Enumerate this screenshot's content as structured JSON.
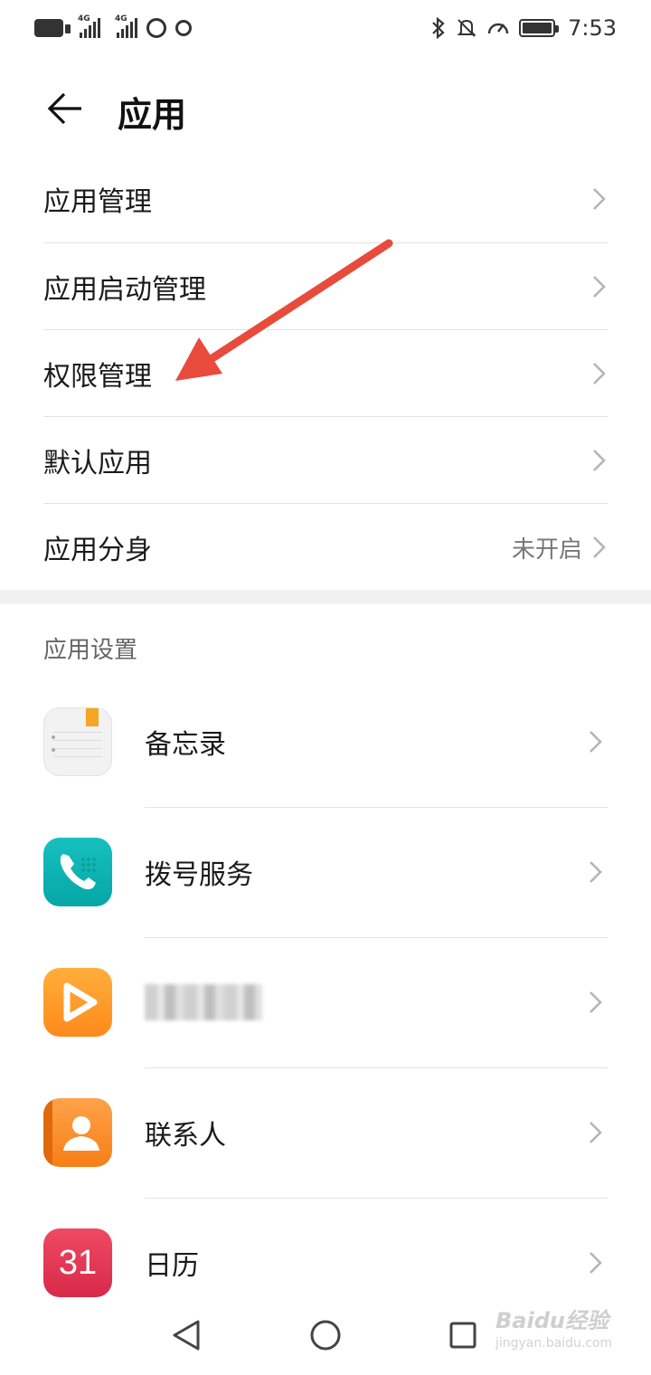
{
  "status_bar": {
    "signal1_label": "4G",
    "signal2_label": "4G",
    "time": "7:53",
    "icons": [
      "hd-icon",
      "signal-icon",
      "signal-icon",
      "alarm-icon",
      "sync-icon",
      "bluetooth-icon",
      "mute-icon",
      "speed-icon",
      "battery-icon"
    ]
  },
  "header": {
    "title": "应用"
  },
  "menu": {
    "items": [
      {
        "label": "应用管理",
        "value": ""
      },
      {
        "label": "应用启动管理",
        "value": ""
      },
      {
        "label": "权限管理",
        "value": ""
      },
      {
        "label": "默认应用",
        "value": ""
      },
      {
        "label": "应用分身",
        "value": "未开启"
      }
    ]
  },
  "app_settings": {
    "section_title": "应用设置",
    "apps": [
      {
        "name": "备忘录",
        "icon": "memo-icon"
      },
      {
        "name": "拨号服务",
        "icon": "dialer-icon"
      },
      {
        "name": "",
        "icon": "video-icon"
      },
      {
        "name": "联系人",
        "icon": "contacts-icon"
      },
      {
        "name": "日历",
        "icon": "calendar-icon",
        "icon_text": "31"
      }
    ]
  },
  "watermark": {
    "brand": "Baidu经验",
    "sub": "jingyan.baidu.com"
  },
  "colors": {
    "annotation_arrow": "#e84b3c",
    "divider": "#e3e3e3",
    "secondary_text": "#777777"
  }
}
